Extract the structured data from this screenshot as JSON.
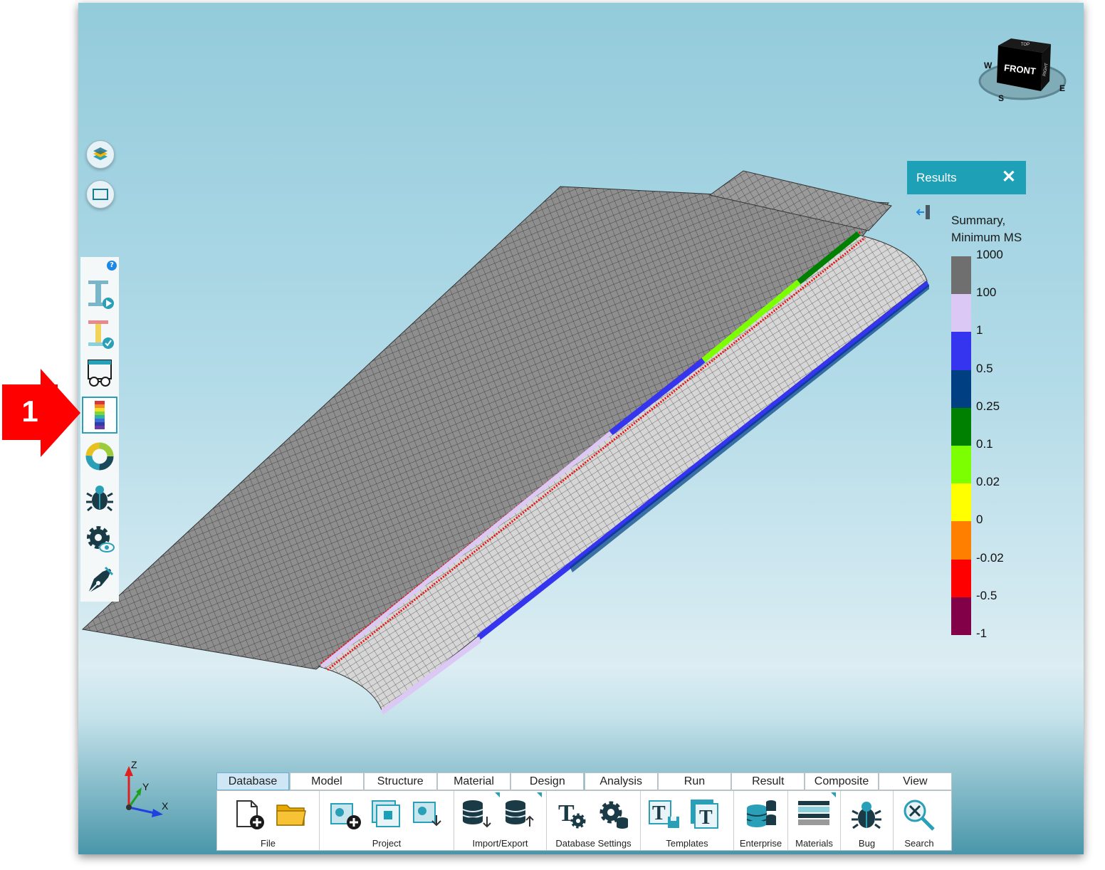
{
  "callout": {
    "number": "1"
  },
  "nav_cube": {
    "front": "FRONT",
    "top": "TOP",
    "right": "RIGHT",
    "compass": [
      "W",
      "S",
      "E"
    ]
  },
  "results_panel": {
    "title": "Results",
    "close_glyph": "✕",
    "legend_title_line1": "Summary,",
    "legend_title_line2": "Minimum MS",
    "legend_labels": [
      "1000",
      "100",
      "1",
      "0.5",
      "0.25",
      "0.1",
      "0.02",
      "0",
      "-0.02",
      "-0.5",
      "-1"
    ],
    "legend_colors": [
      "#6f6f6f",
      "#dcc8f4",
      "#3535f0",
      "#003f82",
      "#008000",
      "#7cff00",
      "#ffff00",
      "#ff8000",
      "#ff0000",
      "#820048"
    ]
  },
  "axes": {
    "z": "Z",
    "y": "Y",
    "x": "X"
  },
  "ribbon": {
    "tabs": [
      "Database",
      "Model",
      "Structure",
      "Material",
      "Design",
      "Analysis",
      "Run",
      "Result",
      "Composite",
      "View"
    ],
    "active_tab": "Database",
    "groups": {
      "file": "File",
      "project": "Project",
      "import_export": "Import/Export",
      "database_settings": "Database Settings",
      "templates": "Templates",
      "enterprise": "Enterprise",
      "materials": "Materials",
      "bug": "Bug",
      "search": "Search"
    }
  },
  "colors": {
    "accent": "#1ea0b6",
    "mesh_gray": "#8c8c8c",
    "callout_red": "#ff0000"
  }
}
